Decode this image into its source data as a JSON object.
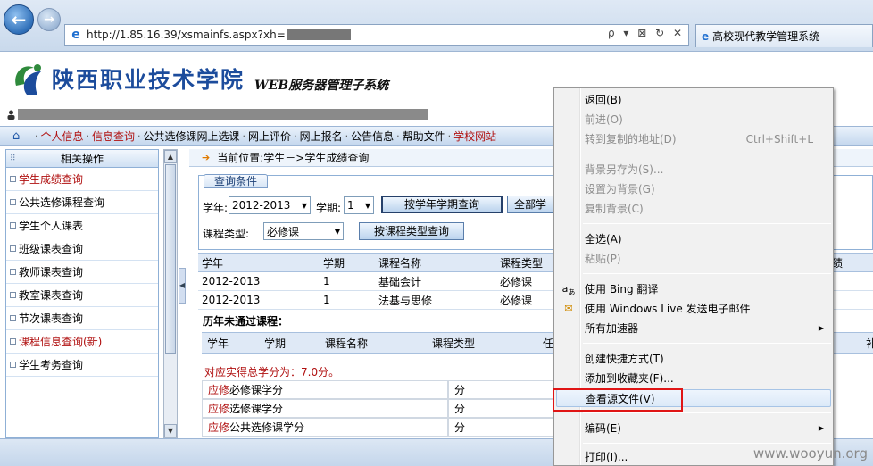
{
  "browser": {
    "url": "http://1.85.16.39/xsmainfs.aspx?xh=",
    "tab_title": "高校现代教学管理系统",
    "back_icon": "back-arrow-icon",
    "forward_icon": "forward-arrow-icon",
    "addr_tools": "ρ ▾ ⊠ ↻ ✕"
  },
  "header": {
    "school_name": "陕西职业技术学院",
    "system_name": "WEB服务器管理子系统"
  },
  "topnav": {
    "items": [
      "个人信息",
      "信息查询",
      "公共选修课网上选课",
      "网上评价",
      "网上报名",
      "公告信息",
      "帮助文件",
      "学校网站"
    ],
    "highlighted": [
      0,
      1,
      7
    ]
  },
  "sidebar": {
    "title": "相关操作",
    "items": [
      {
        "label": "学生成绩查询",
        "red": true
      },
      {
        "label": "公共选修课程查询",
        "red": false
      },
      {
        "label": "学生个人课表",
        "red": false
      },
      {
        "label": "班级课表查询",
        "red": false
      },
      {
        "label": "教师课表查询",
        "red": false
      },
      {
        "label": "教室课表查询",
        "red": false
      },
      {
        "label": "节次课表查询",
        "red": false
      },
      {
        "label": "课程信息查询(新)",
        "red": true
      },
      {
        "label": "学生考务查询",
        "red": false
      }
    ]
  },
  "main": {
    "breadcrumb": "当前位置:学生－>学生成绩查询",
    "query_tab": "查询条件",
    "year_label": "学年:",
    "year_value": "2012-2013",
    "term_label": "学期:",
    "term_value": "1",
    "btn_by_year_term": "按学年学期查询",
    "btn_all": "全部学",
    "course_type_label": "课程类型:",
    "course_type_value": "必修课",
    "btn_by_type": "按课程类型查询",
    "result_headers": [
      "学年",
      "学期",
      "课程名称",
      "课程类型",
      "绩"
    ],
    "result_rows": [
      [
        "2012-2013",
        "1",
        "基础会计",
        "必修课"
      ],
      [
        "2012-2013",
        "1",
        "法基与思修",
        "必修课"
      ]
    ],
    "history_title": "历年未通过课程：",
    "history_headers": [
      "学年",
      "学期",
      "课程名称",
      "课程类型",
      "任",
      "补"
    ],
    "credit_total": "对应实得总学分为：7.0分。",
    "credit_rows": [
      {
        "prefix": "应修",
        "label": "必修课学分",
        "unit": "分"
      },
      {
        "prefix": "应修",
        "label": "选修课学分",
        "unit": "分"
      },
      {
        "prefix": "应修",
        "label": "公共选修课学分",
        "unit": "分"
      }
    ]
  },
  "context_menu": {
    "items": [
      {
        "label": "返回(B)",
        "disabled": false
      },
      {
        "label": "前进(O)",
        "disabled": true
      },
      {
        "label": "转到复制的地址(D)",
        "disabled": true,
        "shortcut": "Ctrl+Shift+L"
      },
      {
        "label": "背景另存为(S)...",
        "disabled": true
      },
      {
        "label": "设置为背景(G)",
        "disabled": true
      },
      {
        "label": "复制背景(C)",
        "disabled": true
      },
      {
        "label": "全选(A)",
        "disabled": false
      },
      {
        "label": "粘贴(P)",
        "disabled": true
      },
      {
        "label": "使用 Bing 翻译",
        "disabled": false
      },
      {
        "label": "使用 Windows Live 发送电子邮件",
        "disabled": false
      },
      {
        "label": "所有加速器",
        "disabled": false
      },
      {
        "label": "创建快捷方式(T)",
        "disabled": false
      },
      {
        "label": "添加到收藏夹(F)...",
        "disabled": false
      },
      {
        "label": "查看源文件(V)",
        "disabled": false
      },
      {
        "label": "编码(E)",
        "disabled": false
      },
      {
        "label": "打印(I)...",
        "disabled": false
      }
    ]
  },
  "watermark": "www.wooyun.org",
  "colors": {
    "accent_red": "#b01010",
    "brand_blue": "#1c4c9c",
    "highlight_box": "#e01515"
  }
}
